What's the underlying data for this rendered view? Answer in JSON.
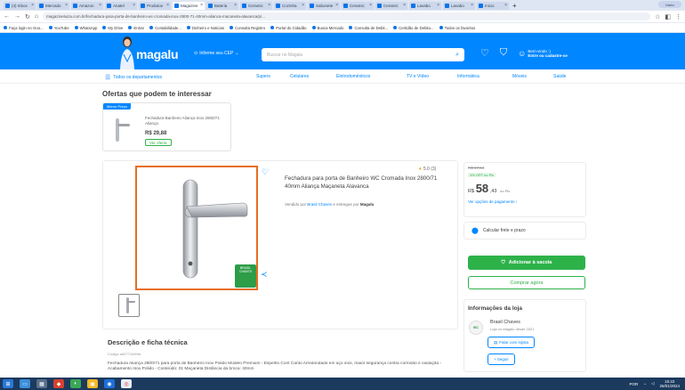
{
  "browser": {
    "tabs": [
      {
        "label": "(4) Inbox"
      },
      {
        "label": "Mercado"
      },
      {
        "label": "Amazon"
      },
      {
        "label": "Anatel"
      },
      {
        "label": "Produtos"
      },
      {
        "label": "Magazine"
      },
      {
        "label": "Bateria"
      },
      {
        "label": "Ceramic"
      },
      {
        "label": "Cozinha"
      },
      {
        "label": "Sabonete"
      },
      {
        "label": "Ceramic"
      },
      {
        "label": "Ceramic"
      },
      {
        "label": "Lavabo"
      },
      {
        "label": "Lavabo"
      },
      {
        "label": "Inicio"
      }
    ],
    "new_tab": "+",
    "profile": "Inicio",
    "url": "magazineluiza.com.br/fechadura-para-porta-de-banheiro-wc-cromada-inox-2800-71-40mm-alianca-macaneta-alavanca/p/...",
    "bookmarks": [
      "Faça login no Goo...",
      "YouTube",
      "WhatsApp",
      "My Drive",
      "Entrar",
      "Contabilidade...",
      "Dinheiro e Noticias",
      "Consulta Registro",
      "Portal do Cidadão",
      "Busca Mercado",
      "Consulta de Debit...",
      "Certidão de Debito...",
      "Todos os favoritos"
    ]
  },
  "header": {
    "logo": "magalu",
    "cep": "Informe seu CEP",
    "search_placeholder": "Buscar no Magalu",
    "login_line1": "Bem-vindo :)",
    "login_line2": "Entre ou cadastre-se"
  },
  "nav": {
    "all": "Todos os departamentos",
    "items": [
      "Supers",
      "Celulares",
      "Eletrodomésticos",
      "TV e Vídeo",
      "Informática",
      "Móveis",
      "Saúde"
    ]
  },
  "offers": {
    "title": "Ofertas que podem te interessar",
    "badge": "Menor Preço",
    "name": "Fechadura Banheiro Aliança Inox 2800/71 Aliança",
    "price": "R$ 29,88",
    "button": "Ver oferta"
  },
  "product": {
    "rating": "5.0 (3)",
    "title": "Fechadura para porta de Banheiro WC Cromada Inox 2800/71 40mm Aliança Maçaneta Alavanca",
    "seller_prefix": "Vendido por",
    "seller": "Brasil Chaves",
    "seller_mid": "e entregue por",
    "delivered_by": "Magalu",
    "seal": "BRASIL CHAVES"
  },
  "pricing": {
    "old_price": "R$ 67,54",
    "discount": "4% OFF no Pix",
    "currency": "R$",
    "price_int": "58",
    "price_cents": ",43",
    "pix": "no Pix",
    "installments": "Ver opções de pagamento",
    "freight": "Calcular frete e prazo",
    "add_cart": "Adicionar à sacola",
    "buy_now": "Comprar agora"
  },
  "store": {
    "title": "Informações da loja",
    "logo": "BC",
    "name": "Brasil Chaves",
    "since": "Loja no Magalu desde 2021",
    "chat": "Falar com lojista",
    "follow": "+ Seguir"
  },
  "description": {
    "title": "Descrição e ficha técnica",
    "code": "Código a65771k99fa",
    "text": "Fechadura Aliança 2800/71 para porta de Banheiro Inox Polido Modelo Premium - Espelho Cont Canto Arredondado em aço inox, maior segurança contra corrosão e oxidação - Acabamento Inox Polido - Conteúdo: 01 Maçaneta Distância da broca: 40mm"
  },
  "taskbar": {
    "time": "15:22",
    "date": "26/01/2024",
    "lang": "POR"
  }
}
